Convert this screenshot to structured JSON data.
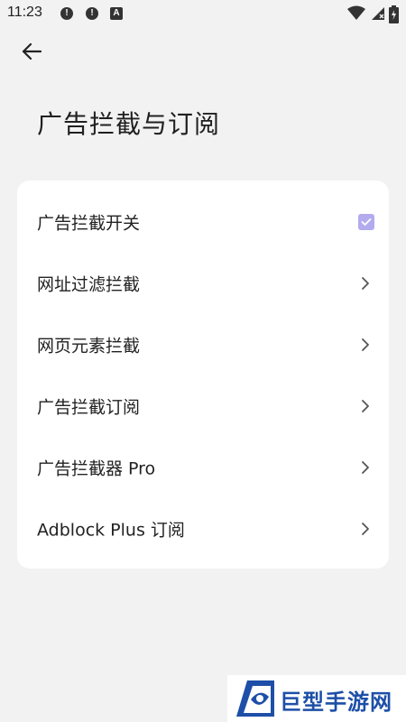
{
  "status_bar": {
    "time": "11:23",
    "notifications": [
      "!",
      "!",
      "A"
    ]
  },
  "header": {
    "back_icon": "arrow-left-icon",
    "title": "广告拦截与订阅"
  },
  "settings": {
    "items": [
      {
        "label": "广告拦截开关",
        "control": "checkbox",
        "checked": true
      },
      {
        "label": "网址过滤拦截",
        "control": "chevron"
      },
      {
        "label": "网页元素拦截",
        "control": "chevron"
      },
      {
        "label": "广告拦截订阅",
        "control": "chevron"
      },
      {
        "label": "广告拦截器 Pro",
        "control": "chevron"
      },
      {
        "label": "Adblock Plus 订阅",
        "control": "chevron"
      }
    ]
  },
  "watermark": {
    "text": "巨型手游网"
  },
  "colors": {
    "background": "#f2f2f2",
    "card": "#ffffff",
    "checkbox": "#b3abee",
    "watermark_blue": "#1d4fa8"
  }
}
